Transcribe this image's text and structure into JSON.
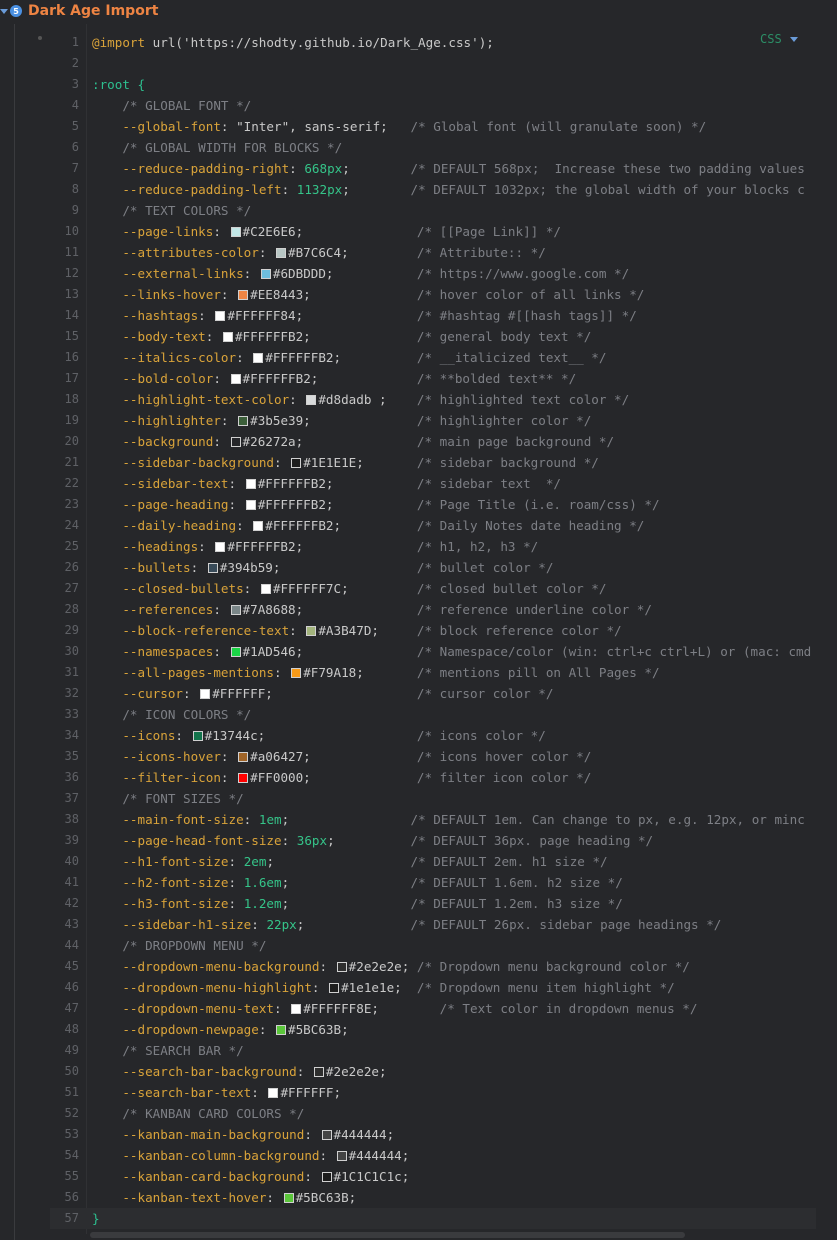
{
  "block": {
    "badge": "5",
    "title": "Dark Age Import",
    "language": "CSS"
  },
  "code_lines": [
    {
      "n": "1",
      "t": "@import url('https://shodty.github.io/Dark_Age.css');"
    },
    {
      "n": "2",
      "t": ""
    },
    {
      "n": "3",
      "t": ":root {"
    },
    {
      "n": "4",
      "t": "    /* GLOBAL FONT */"
    },
    {
      "n": "5",
      "t": "    --global-font: \"Inter\", sans-serif;   /* Global font (will granulate soon) */"
    },
    {
      "n": "6",
      "t": "    /* GLOBAL WIDTH FOR BLOCKS */"
    },
    {
      "n": "7",
      "t": "    --reduce-padding-right: 668px;        /* DEFAULT 568px;  Increase these two padding values"
    },
    {
      "n": "8",
      "t": "    --reduce-padding-left: 1132px;        /* DEFAULT 1032px; the global width of your blocks c"
    },
    {
      "n": "9",
      "t": "    /* TEXT COLORS */"
    },
    {
      "n": "10",
      "t": "    --page-links:  #C2E6E6;               /* [[Page Link]] */",
      "sw": "#C2E6E6"
    },
    {
      "n": "11",
      "t": "    --attributes-color:  #B7C6C4;         /* Attribute:: */",
      "sw": "#B7C6C4"
    },
    {
      "n": "12",
      "t": "    --external-links:  #6DBDDD;           /* https://www.google.com */",
      "sw": "#6DBDDD"
    },
    {
      "n": "13",
      "t": "    --links-hover:  #EE8443;              /* hover color of all links */",
      "sw": "#EE8443"
    },
    {
      "n": "14",
      "t": "    --hashtags:  #FFFFFF84;               /* #hashtag #[[hash tags]] */",
      "sw": "#FFFFFF"
    },
    {
      "n": "15",
      "t": "    --body-text:  #FFFFFFB2;              /* general body text */",
      "sw": "#FFFFFF"
    },
    {
      "n": "16",
      "t": "    --italics-color:  #FFFFFFB2;          /* __italicized text__ */",
      "sw": "#FFFFFF"
    },
    {
      "n": "17",
      "t": "    --bold-color:  #FFFFFFB2;             /* **bolded text** */",
      "sw": "#FFFFFF"
    },
    {
      "n": "18",
      "t": "    --highlight-text-color:  #d8dadb ;    /* highlighted text color */",
      "sw": "#d8dadb"
    },
    {
      "n": "19",
      "t": "    --highlighter:  #3b5e39;              /* highlighter color */",
      "sw": "#3b5e39"
    },
    {
      "n": "20",
      "t": "    --background:  #26272a;               /* main page background */",
      "sw": "#26272a"
    },
    {
      "n": "21",
      "t": "    --sidebar-background:  #1E1E1E;       /* sidebar background */",
      "sw": "#1E1E1E"
    },
    {
      "n": "22",
      "t": "    --sidebar-text:  #FFFFFFB2;           /* sidebar text  */",
      "sw": "#FFFFFF"
    },
    {
      "n": "23",
      "t": "    --page-heading:  #FFFFFFB2;           /* Page Title (i.e. roam/css) */",
      "sw": "#FFFFFF"
    },
    {
      "n": "24",
      "t": "    --daily-heading:  #FFFFFFB2;          /* Daily Notes date heading */",
      "sw": "#FFFFFF"
    },
    {
      "n": "25",
      "t": "    --headings:  #FFFFFFB2;               /* h1, h2, h3 */",
      "sw": "#FFFFFF"
    },
    {
      "n": "26",
      "t": "    --bullets:  #394b59;                  /* bullet color */",
      "sw": "#394b59"
    },
    {
      "n": "27",
      "t": "    --closed-bullets:  #FFFFFF7C;         /* closed bullet color */",
      "sw": "#FFFFFF"
    },
    {
      "n": "28",
      "t": "    --references:  #7A8688;               /* reference underline color */",
      "sw": "#7A8688"
    },
    {
      "n": "29",
      "t": "    --block-reference-text:  #A3B47D;     /* block reference color */",
      "sw": "#A3B47D"
    },
    {
      "n": "30",
      "t": "    --namespaces:  #1AD546;               /* Namespace/color (win: ctrl+c ctrl+L) or (mac: cmd",
      "sw": "#1AD546"
    },
    {
      "n": "31",
      "t": "    --all-pages-mentions:  #F79A18;       /* mentions pill on All Pages */",
      "sw": "#F79A18"
    },
    {
      "n": "32",
      "t": "    --cursor:  #FFFFFF;                   /* cursor color */",
      "sw": "#FFFFFF"
    },
    {
      "n": "33",
      "t": "    /* ICON COLORS */"
    },
    {
      "n": "34",
      "t": "    --icons:  #13744c;                    /* icons color */",
      "sw": "#13744c"
    },
    {
      "n": "35",
      "t": "    --icons-hover:  #a06427;              /* icons hover color */",
      "sw": "#a06427"
    },
    {
      "n": "36",
      "t": "    --filter-icon:  #FF0000;              /* filter icon color */",
      "sw": "#FF0000"
    },
    {
      "n": "37",
      "t": "    /* FONT SIZES */"
    },
    {
      "n": "38",
      "t": "    --main-font-size: 1em;                /* DEFAULT 1em. Can change to px, e.g. 12px, or minc"
    },
    {
      "n": "39",
      "t": "    --page-head-font-size: 36px;          /* DEFAULT 36px. page heading */"
    },
    {
      "n": "40",
      "t": "    --h1-font-size: 2em;                  /* DEFAULT 2em. h1 size */"
    },
    {
      "n": "41",
      "t": "    --h2-font-size: 1.6em;                /* DEFAULT 1.6em. h2 size */"
    },
    {
      "n": "42",
      "t": "    --h3-font-size: 1.2em;                /* DEFAULT 1.2em. h3 size */"
    },
    {
      "n": "43",
      "t": "    --sidebar-h1-size: 22px;              /* DEFAULT 26px. sidebar page headings */"
    },
    {
      "n": "44",
      "t": "    /* DROPDOWN MENU */"
    },
    {
      "n": "45",
      "t": "    --dropdown-menu-background:  #2e2e2e; /* Dropdown menu background color */",
      "sw": "#2e2e2e"
    },
    {
      "n": "46",
      "t": "    --dropdown-menu-highlight:  #1e1e1e;  /* Dropdown menu item highlight */",
      "sw": "#1e1e1e"
    },
    {
      "n": "47",
      "t": "    --dropdown-menu-text:  #FFFFFF8E;        /* Text color in dropdown menus */",
      "sw": "#FFFFFF"
    },
    {
      "n": "48",
      "t": "    --dropdown-newpage:  #5BC63B;",
      "sw": "#5BC63B"
    },
    {
      "n": "49",
      "t": "    /* SEARCH BAR */"
    },
    {
      "n": "50",
      "t": "    --search-bar-background:  #2e2e2e;",
      "sw": "#2e2e2e"
    },
    {
      "n": "51",
      "t": "    --search-bar-text:  #FFFFFF;",
      "sw": "#FFFFFF"
    },
    {
      "n": "52",
      "t": "    /* KANBAN CARD COLORS */"
    },
    {
      "n": "53",
      "t": "    --kanban-main-background:  #444444;",
      "sw": "#444444"
    },
    {
      "n": "54",
      "t": "    --kanban-column-background:  #444444;",
      "sw": "#444444"
    },
    {
      "n": "55",
      "t": "    --kanban-card-background:  #1C1C1C1c;",
      "sw": "#1C1C1C"
    },
    {
      "n": "56",
      "t": "    --kanban-text-hover:  #5BC63B;",
      "sw": "#5BC63B"
    },
    {
      "n": "57",
      "t": "}"
    }
  ]
}
